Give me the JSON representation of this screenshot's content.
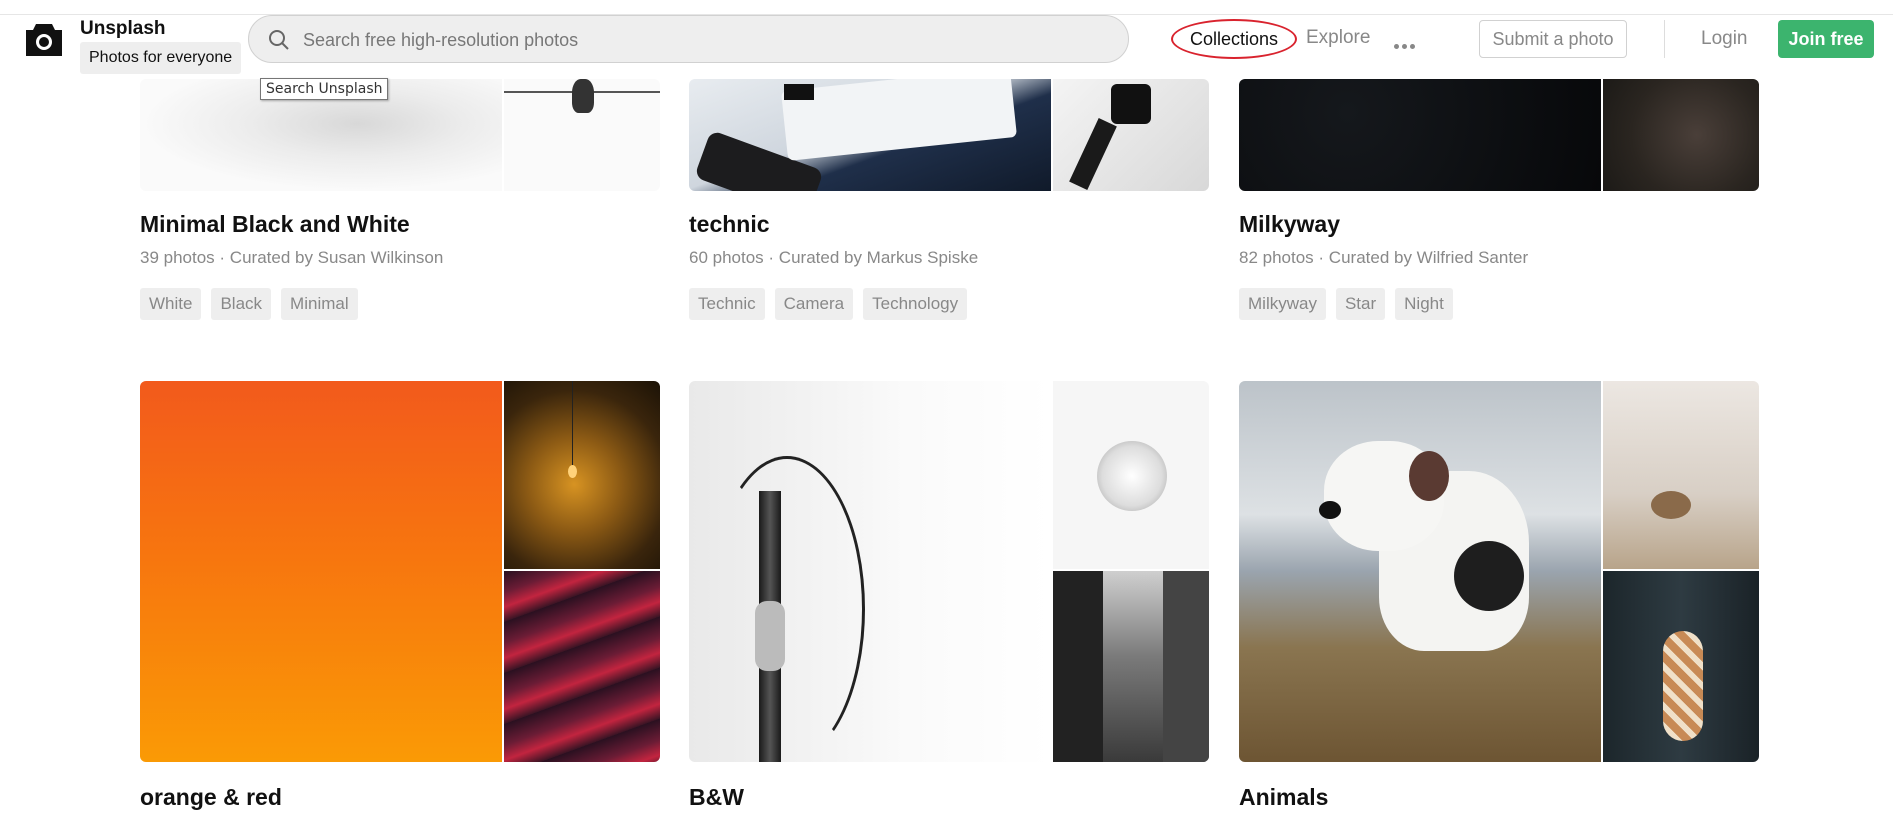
{
  "header": {
    "brand_name": "Unsplash",
    "brand_tagline": "Photos for everyone",
    "search_placeholder": "Search free high-resolution photos",
    "tooltip": "Search Unsplash",
    "nav": {
      "collections": "Collections",
      "explore": "Explore",
      "more": "more-icon"
    },
    "submit": "Submit a photo",
    "login": "Login",
    "join": "Join free"
  },
  "collections": [
    {
      "title": "Minimal Black and White",
      "photos": "39 photos",
      "curator": "Curated by Susan Wilkinson",
      "tags": [
        "White",
        "Black",
        "Minimal"
      ]
    },
    {
      "title": "technic",
      "photos": "60 photos",
      "curator": "Curated by Markus Spiske",
      "tags": [
        "Technic",
        "Camera",
        "Technology"
      ]
    },
    {
      "title": "Milkyway",
      "photos": "82 photos",
      "curator": "Curated by Wilfried Santer",
      "tags": [
        "Milkyway",
        "Star",
        "Night"
      ]
    },
    {
      "title": "orange & red"
    },
    {
      "title": "B&W"
    },
    {
      "title": "Animals"
    }
  ],
  "colors": {
    "join_button": "#3cb46e",
    "highlight_ring": "#d9232e"
  }
}
